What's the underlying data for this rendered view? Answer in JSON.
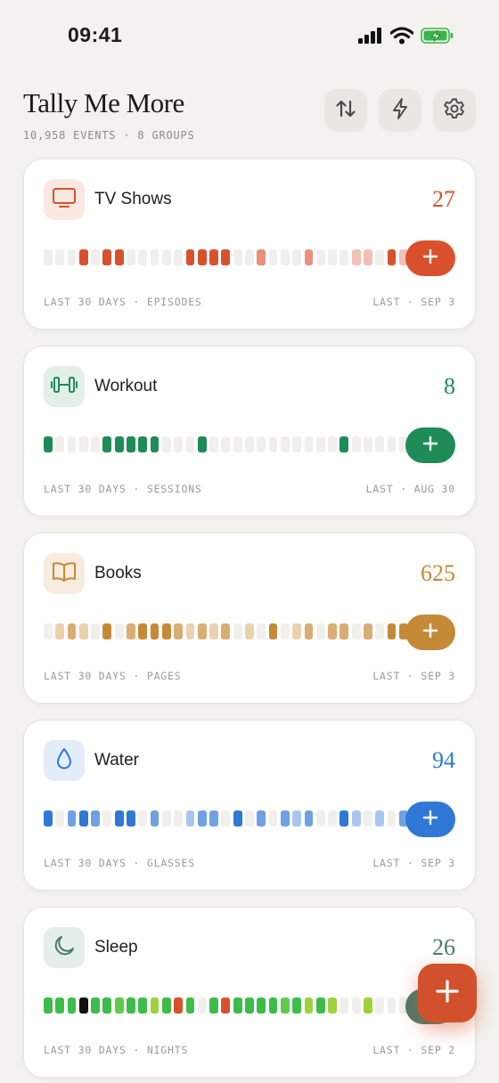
{
  "status_bar": {
    "time": "09:41"
  },
  "header": {
    "title": "Tally Me More",
    "subtitle": "10,958 EVENTS · 8 GROUPS",
    "buttons": [
      {
        "name": "sort-button",
        "icon": "sort-arrows-icon"
      },
      {
        "name": "quick-actions-button",
        "icon": "lightning-icon"
      },
      {
        "name": "settings-button",
        "icon": "gear-icon"
      }
    ]
  },
  "groups": [
    {
      "id": "tv-shows",
      "name": "TV Shows",
      "count": "27",
      "icon": "tv-icon",
      "accent": "#d9512c",
      "icon_bg": "#fbe8e1",
      "colors": [
        "#f1efec",
        "#d9512c",
        "#e98f7a",
        "#f2c0b4"
      ],
      "levels": [
        0,
        0,
        0,
        1,
        0,
        1,
        1,
        0,
        0,
        0,
        0,
        0,
        1,
        1,
        1,
        1,
        0,
        0,
        2,
        0,
        0,
        0,
        2,
        0,
        0,
        0,
        3,
        3,
        0,
        1,
        3,
        3
      ],
      "footer_left": "LAST 30 DAYS · EPISODES",
      "footer_right": "LAST · SEP 3"
    },
    {
      "id": "workout",
      "name": "Workout",
      "count": "8",
      "icon": "dumbbell-icon",
      "accent": "#1f8c58",
      "icon_bg": "#e2f0e8",
      "colors": [
        "#f1efec",
        "#1f8c58"
      ],
      "levels": [
        1,
        0,
        0,
        0,
        0,
        1,
        1,
        1,
        1,
        1,
        0,
        0,
        0,
        1,
        0,
        0,
        0,
        0,
        0,
        0,
        0,
        0,
        0,
        0,
        0,
        1,
        0,
        0,
        0,
        0,
        0,
        0
      ],
      "footer_left": "LAST 30 DAYS · SESSIONS",
      "footer_right": "LAST · AUG 30"
    },
    {
      "id": "books",
      "name": "Books",
      "count": "625",
      "icon": "book-icon",
      "accent": "#c48a37",
      "icon_bg": "#f7ecdd",
      "colors": [
        "#f1efec",
        "#c48a37",
        "#d9ad73",
        "#ead2ae"
      ],
      "levels": [
        0,
        3,
        2,
        3,
        0,
        1,
        0,
        2,
        1,
        1,
        1,
        2,
        3,
        2,
        3,
        2,
        0,
        3,
        0,
        1,
        0,
        3,
        2,
        0,
        2,
        2,
        0,
        2,
        0,
        1,
        1,
        1
      ],
      "footer_left": "LAST 30 DAYS · PAGES",
      "footer_right": "LAST · SEP 3"
    },
    {
      "id": "water",
      "name": "Water",
      "count": "94",
      "icon": "water-drop-icon",
      "accent": "#2f78d6",
      "icon_bg": "#e3edf9",
      "colors": [
        "#f1efec",
        "#2f78d6",
        "#6fa1e3",
        "#a9c7ee"
      ],
      "levels": [
        1,
        0,
        2,
        1,
        2,
        0,
        1,
        1,
        0,
        2,
        0,
        0,
        3,
        2,
        2,
        0,
        1,
        0,
        2,
        0,
        2,
        3,
        2,
        0,
        0,
        1,
        3,
        0,
        3,
        0,
        2,
        2
      ],
      "footer_left": "LAST 30 DAYS · GLASSES",
      "footer_right": "LAST · SEP 3"
    },
    {
      "id": "sleep",
      "name": "Sleep",
      "count": "26",
      "icon": "moon-icon",
      "accent": "#4b7a6c",
      "icon_bg": "#e6eeec",
      "colors": [
        "#f1efec",
        "#3cbd4a",
        "#9ed13b",
        "#111111",
        "#d9512c",
        "#62c94e"
      ],
      "levels": [
        1,
        1,
        1,
        3,
        1,
        1,
        5,
        1,
        1,
        2,
        1,
        4,
        1,
        0,
        1,
        4,
        1,
        1,
        1,
        1,
        5,
        1,
        2,
        1,
        2,
        0,
        0,
        2,
        0,
        0,
        0,
        0
      ],
      "footer_left": "LAST 30 DAYS · NIGHTS",
      "footer_right": "LAST · SEP 2"
    }
  ],
  "fab": {
    "icon": "plus-icon",
    "color": "#d2512c"
  }
}
